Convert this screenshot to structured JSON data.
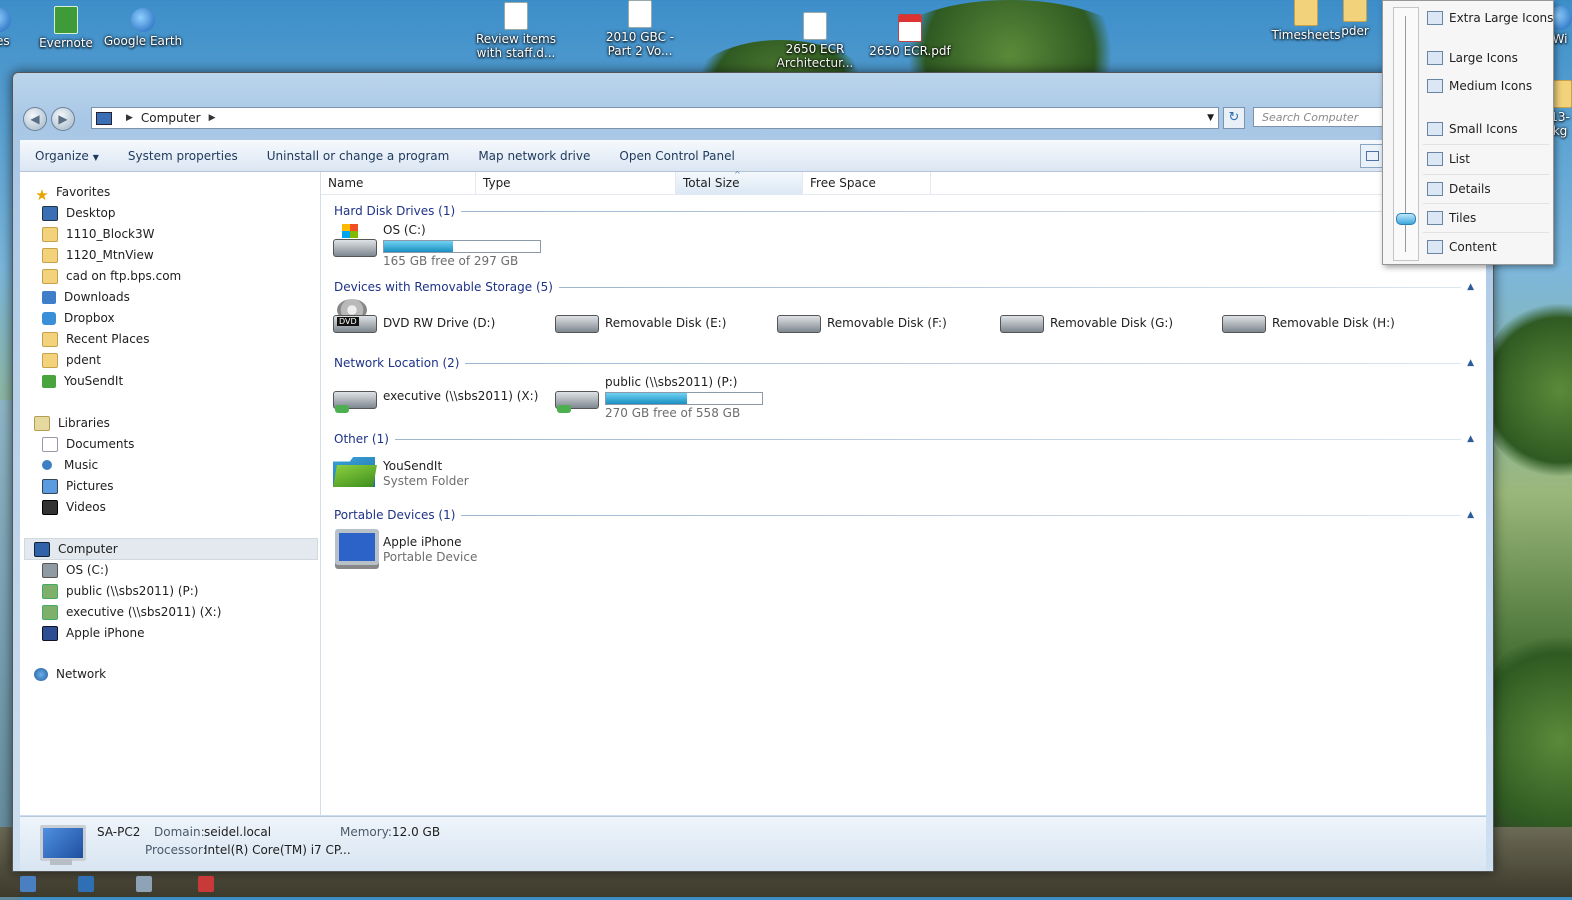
{
  "desktop": {
    "icons": [
      {
        "label": "nes",
        "x_name": "desktop-icon-partial-left"
      },
      {
        "label": "Evernote"
      },
      {
        "label": "Google Earth"
      },
      {
        "label": "Review items with staff.d..."
      },
      {
        "label": "2010 GBC - Part 2 Vo..."
      },
      {
        "label": "2650 ECR Architectur..."
      },
      {
        "label": "2650 ECR.pdf"
      },
      {
        "label": "Timesheets"
      },
      {
        "label": "pder"
      },
      {
        "label": "Wi"
      },
      {
        "label": "13-"
      },
      {
        "label": "kg"
      }
    ]
  },
  "explorer": {
    "breadcrumb": {
      "root": "Computer"
    },
    "search_placeholder": "Search Computer",
    "toolbar": {
      "organize": "Organize",
      "system_properties": "System properties",
      "uninstall": "Uninstall or change a program",
      "map_drive": "Map network drive",
      "control_panel": "Open Control Panel"
    },
    "nav": {
      "favorites": "Favorites",
      "favorites_items": [
        "Desktop",
        "1110_Block3W",
        "1120_MtnView",
        "cad on ftp.bps.com",
        "Downloads",
        "Dropbox",
        "Recent Places",
        "pdent",
        "YouSendIt"
      ],
      "libraries": "Libraries",
      "libraries_items": [
        "Documents",
        "Music",
        "Pictures",
        "Videos"
      ],
      "computer": "Computer",
      "computer_items": [
        "OS (C:)",
        "public (\\\\sbs2011) (P:)",
        "executive (\\\\sbs2011) (X:)",
        "Apple iPhone"
      ],
      "network": "Network"
    },
    "columns": [
      "Name",
      "Type",
      "Total Size",
      "Free Space"
    ],
    "groups": {
      "hdd": "Hard Disk Drives (1)",
      "removable": "Devices with Removable Storage (5)",
      "network": "Network Location (2)",
      "other": "Other (1)",
      "portable": "Portable Devices (1)"
    },
    "items": {
      "os": {
        "name": "OS (C:)",
        "free": "165 GB free of 297 GB",
        "used_fraction": 0.44
      },
      "dvd": {
        "name": "DVD RW Drive (D:)",
        "badge": "DVD"
      },
      "rem_e": {
        "name": "Removable Disk (E:)"
      },
      "rem_f": {
        "name": "Removable Disk (F:)"
      },
      "rem_g": {
        "name": "Removable Disk (G:)"
      },
      "rem_h": {
        "name": "Removable Disk (H:)"
      },
      "executive": {
        "name": "executive (\\\\sbs2011) (X:)"
      },
      "public": {
        "name": "public (\\\\sbs2011) (P:)",
        "free": "270 GB free of 558 GB",
        "used_fraction": 0.52
      },
      "yousendit": {
        "name": "YouSendIt",
        "sub": "System Folder"
      },
      "iphone": {
        "name": "Apple iPhone",
        "sub": "Portable Device"
      }
    },
    "details": {
      "pc_name": "SA-PC2",
      "domain_label": "Domain:",
      "domain": "seidel.local",
      "memory_label": "Memory:",
      "memory": "12.0 GB",
      "processor_label": "Processor:",
      "processor": "Intel(R) Core(TM) i7 CP..."
    }
  },
  "view_menu": {
    "items": [
      "Extra Large Icons",
      "Large Icons",
      "Medium Icons",
      "Small Icons",
      "List",
      "Details",
      "Tiles",
      "Content"
    ],
    "selected": "Tiles"
  }
}
